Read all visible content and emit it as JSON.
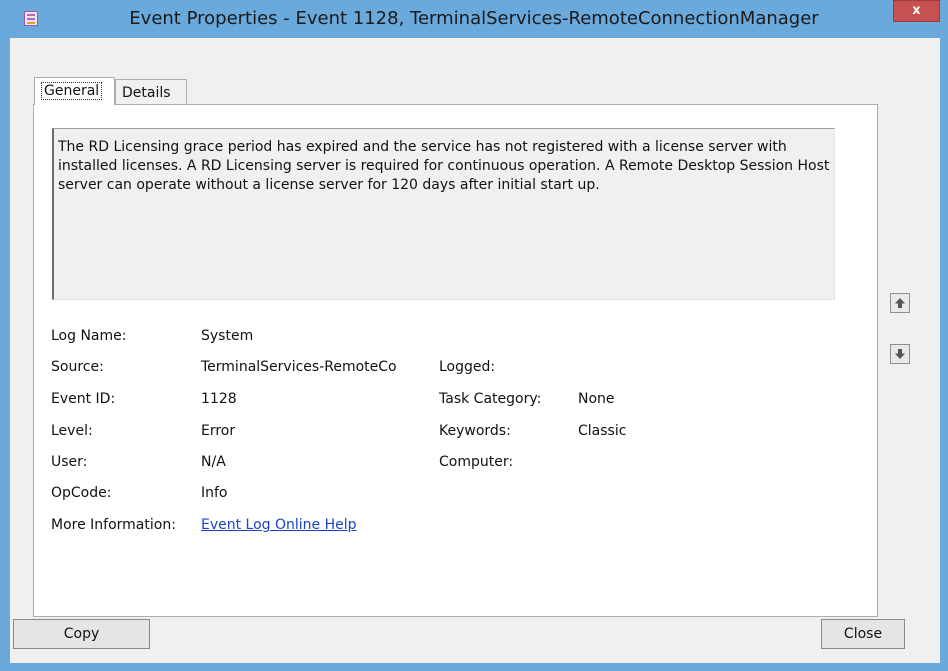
{
  "window": {
    "title": "Event Properties - Event 1128, TerminalServices-RemoteConnectionManager",
    "close_label": "x"
  },
  "tabs": [
    {
      "label": "General",
      "selected": true
    },
    {
      "label": "Details",
      "selected": false
    }
  ],
  "description": "The RD Licensing grace period has expired and the service has not registered with a license server with installed licenses. A RD Licensing server is required for continuous operation. A Remote Desktop Session Host server can operate without a license server for 120 days after initial start up.",
  "fields": {
    "log_name": {
      "label": "Log Name:",
      "value": "System"
    },
    "source": {
      "label": "Source:",
      "value": "TerminalServices-RemoteCo"
    },
    "event_id": {
      "label": "Event ID:",
      "value": "1128"
    },
    "level": {
      "label": "Level:",
      "value": "Error"
    },
    "user": {
      "label": "User:",
      "value": "N/A"
    },
    "opcode": {
      "label": "OpCode:",
      "value": "Info"
    },
    "more_info": {
      "label": "More Information:",
      "value": "Event Log Online Help"
    },
    "logged": {
      "label": "Logged:",
      "value": ""
    },
    "task_category": {
      "label": "Task Category:",
      "value": "None"
    },
    "keywords": {
      "label": "Keywords:",
      "value": "Classic"
    },
    "computer": {
      "label": "Computer:",
      "value": ""
    }
  },
  "buttons": {
    "copy": "Copy",
    "close": "Close"
  },
  "icons": {
    "up": "arrow-up-icon",
    "down": "arrow-down-icon",
    "app": "event-log-icon"
  },
  "colors": {
    "title_bar": "#6aa9dc",
    "close_button": "#c75050",
    "link": "#1a43c8"
  }
}
